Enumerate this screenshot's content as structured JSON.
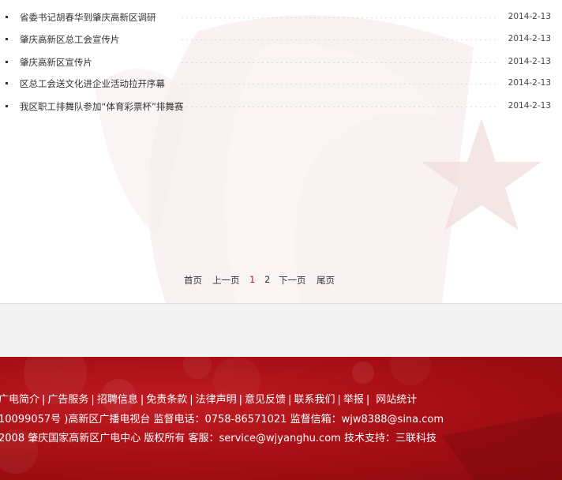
{
  "news": [
    {
      "title": "省委书记胡春华到肇庆高新区调研",
      "date": "2014-2-13"
    },
    {
      "title": "肇庆高新区总工会宣传片",
      "date": "2014-2-13"
    },
    {
      "title": "肇庆高新区宣传片",
      "date": "2014-2-13"
    },
    {
      "title": "区总工会送文化进企业活动拉开序幕",
      "date": "2014-2-13"
    },
    {
      "title": "我区职工排舞队参加“体育彩票杯”排舞赛",
      "date": "2014-2-13"
    }
  ],
  "pagination": {
    "first": "首页",
    "prev": "上一页",
    "page1": "1",
    "page2": "2",
    "next": "下一页",
    "last": "尾页"
  },
  "footer": {
    "links": [
      "广电简介",
      "广告服务",
      "招聘信息",
      "免责条款",
      "法律声明",
      "意见反馈",
      "联系我们",
      "举报",
      "网站统计"
    ],
    "separator": "|",
    "line2": "10099057号 )高新区广播电视台  监督电话：0758-86571021  监督信箱：wjw8388@sina.com",
    "line3": "2008 肇庆国家高新区广电中心 版权所有  客服：service@wjyanghu.com  技术支持：三联科技"
  },
  "colors": {
    "accent_red": "#c0141b",
    "footer_red": "#a40e14",
    "text": "#333333"
  }
}
